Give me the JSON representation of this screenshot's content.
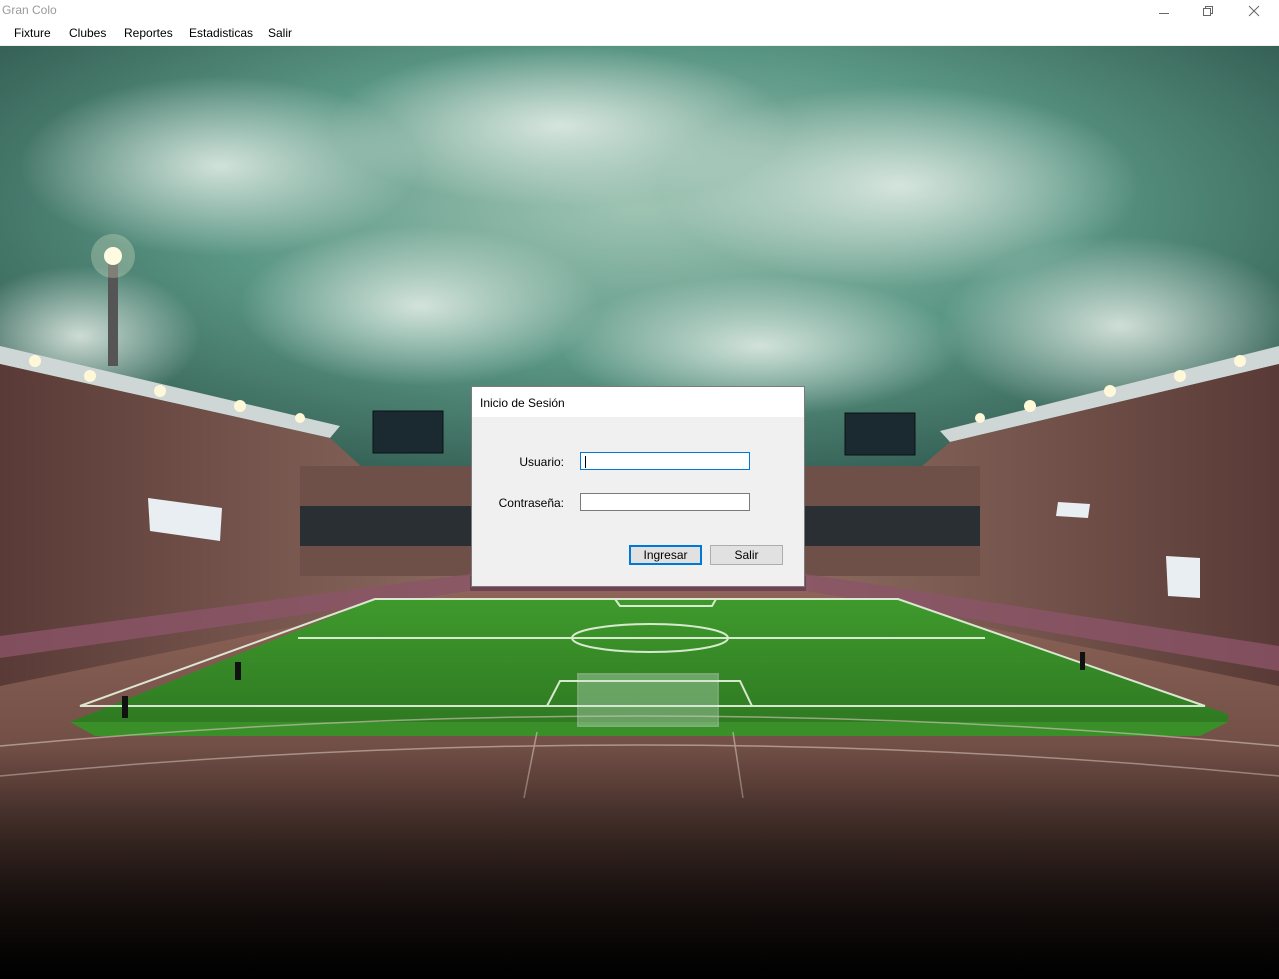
{
  "window": {
    "title": "Gran Colo"
  },
  "menu": {
    "items": [
      "Fixture",
      "Clubes",
      "Reportes",
      "Estadisticas",
      "Salir"
    ]
  },
  "dialog": {
    "title": "Inicio de Sesión",
    "username_label": "Usuario:",
    "password_label": "Contraseña:",
    "username_value": "",
    "password_value": "",
    "login_button": "Ingresar",
    "exit_button": "Salir"
  },
  "colors": {
    "focus_accent": "#0078d7",
    "dialog_bg": "#f0f0f0",
    "pitch": "#3d8a2a",
    "sky": "#4e8f7f"
  },
  "icons": [
    "minimize-icon",
    "restore-icon",
    "close-icon"
  ]
}
